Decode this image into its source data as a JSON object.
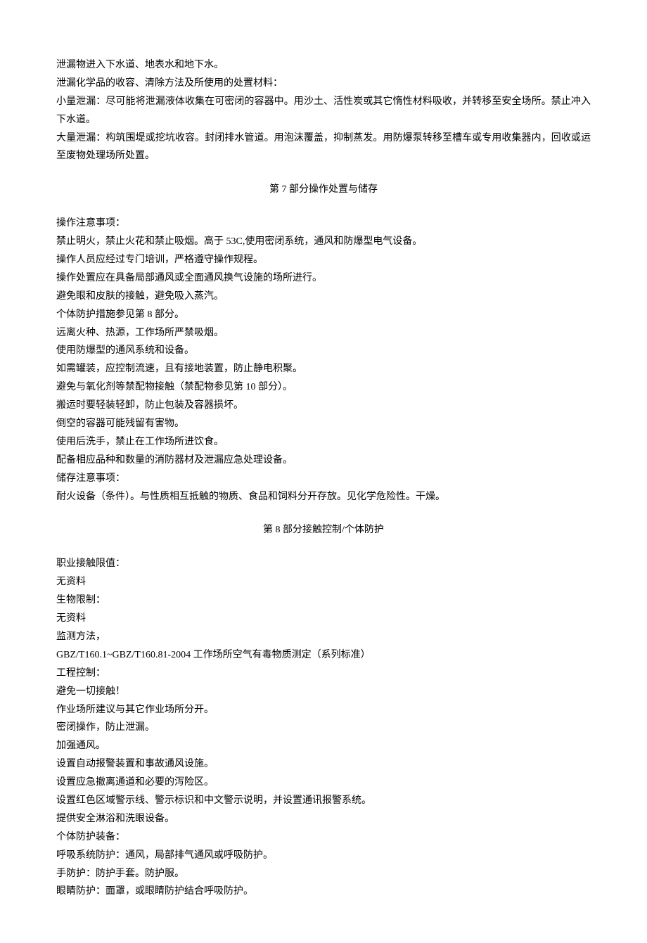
{
  "intro": {
    "line1": "泄漏物进入下水道、地表水和地下水。",
    "line2": "泄漏化学品的收容、清除方法及所使用的处置材料：",
    "line3": "小量泄漏：尽可能将泄漏液体收集在可密闭的容器中。用沙土、活性炭或其它惰性材料吸收，并转移至安全场所。禁止冲入下水道。",
    "line4": "大量泄漏：构筑围堤或挖坑收容。封闭排水管道。用泡沫覆盖，抑制蒸发。用防爆泵转移至槽车或专用收集器内，回收或运至废物处理场所处置。"
  },
  "section7": {
    "title": "第 7 部分操作处置与储存",
    "line1": "操作注意事项：",
    "line2": "禁止明火，禁止火花和禁止吸烟。高于 53C,使用密闭系统，通风和防爆型电气设备。",
    "line3": "操作人员应经过专门培训，严格遵守操作规程。",
    "line4": "操作处置应在具备局部通风或全面通风换气设施的场所进行。",
    "line5": "避免眼和皮肤的接触，避免吸入蒸汽。",
    "line6": "个体防护措施参见第 8 部分。",
    "line7": "远离火种、热源，工作场所严禁吸烟。",
    "line8": "使用防爆型的通风系统和设备。",
    "line9": "如需罐装，应控制流速，且有接地装置，防止静电积聚。",
    "line10": "避免与氧化剂等禁配物接触（禁配物参见第 10 部分）。",
    "line11": "搬运时要轻装轻卸，防止包装及容器损坏。",
    "line12": "倒空的容器可能残留有害物。",
    "line13": "使用后洗手，禁止在工作场所进饮食。",
    "line14": "配备相应品种和数量的消防器材及泄漏应急处理设备。",
    "line15": "储存注意事项：",
    "line16": "耐火设备（条件）。与性质相互抵触的物质、食品和饲料分开存放。见化学危险性。干燥。"
  },
  "section8": {
    "title": "第 8 部分接触控制/个体防护",
    "line1": "职业接触限值：",
    "line2": "无资料",
    "line3": "生物限制：",
    "line4": "无资料",
    "line5": "监测方法，",
    "line6": "GBZ/T160.1~GBZ/T160.81-2004 工作场所空气有毒物质测定（系列标准）",
    "line7": "工程控制：",
    "line8": "避免一切接触！",
    "line9": "作业场所建议与其它作业场所分开。",
    "line10": "密闭操作，防止泄漏。",
    "line11": "加强通风。",
    "line12": "设置自动报警装置和事故通风设施。",
    "line13": "设置应急撤离通道和必要的泻险区。",
    "line14": "设置红色区域警示线、警示标识和中文警示说明，并设置通讯报警系统。",
    "line15": "提供安全淋浴和洗眼设备。",
    "line16": "个体防护装备：",
    "line17": "呼吸系统防护：通风，局部排气通风或呼吸防护。",
    "line18": "手防护：防护手套。防护服。",
    "line19": "眼睛防护：面罩，或眼睛防护结合呼吸防护。"
  }
}
